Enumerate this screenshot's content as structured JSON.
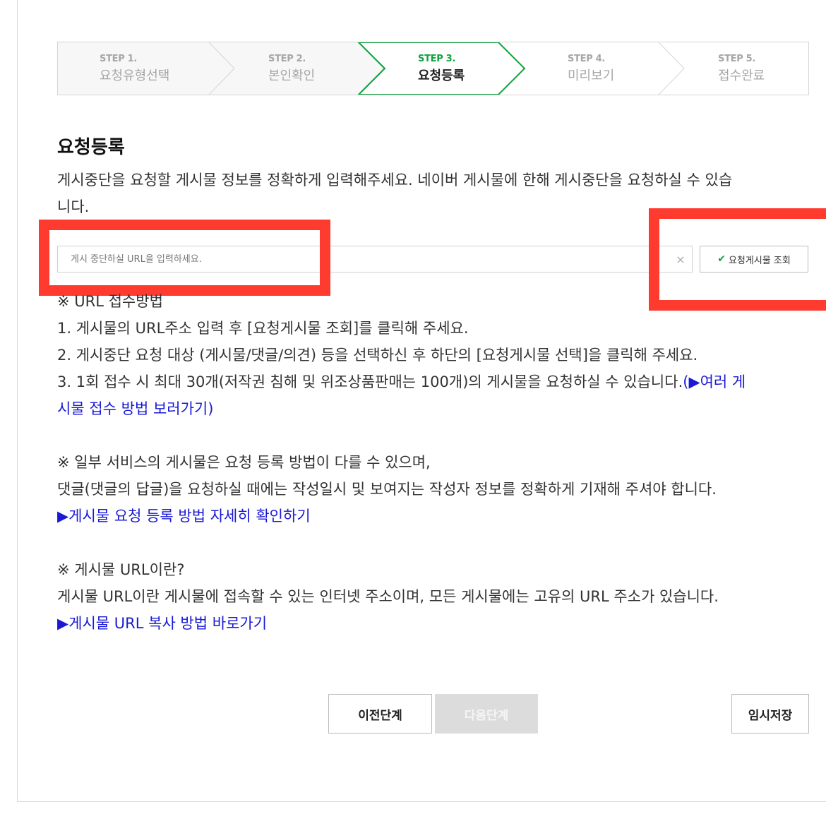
{
  "steps": [
    {
      "num": "STEP 1.",
      "label": "요청유형선택",
      "active": false
    },
    {
      "num": "STEP 2.",
      "label": "본인확인",
      "active": false
    },
    {
      "num": "STEP 3.",
      "label": "요청등록",
      "active": true
    },
    {
      "num": "STEP 4.",
      "label": "미리보기",
      "active": false
    },
    {
      "num": "STEP 5.",
      "label": "접수완료",
      "active": false
    }
  ],
  "section": {
    "title": "요청등록",
    "desc_line1": "게시중단을 요청할 게시물 정보를 정확하게 입력해주세요. 네이버 게시물에 한해 게시중단을 요청하실 수 있습",
    "desc_line2": "니다."
  },
  "url_search": {
    "placeholder": "게시 중단하실 URL을 입력하세요.",
    "clear_label": "×",
    "lookup_label": "요청게시물 조회",
    "lookup_icon": "✔"
  },
  "guide": {
    "header": "※ URL 접수방법",
    "step1": "1. 게시물의 URL주소 입력 후 [요청게시물 조회]를 클릭해 주세요.",
    "step2": "2. 게시중단 요청 대상 (게시물/댓글/의견) 등을 선택하신 후 하단의 [요청게시물 선택]을 클릭해 주세요.",
    "step3": "3. 1회 접수 시 최대 30개(저작권 침해 및 위조상품판매는 100개)의 게시물을 요청하실 수 있습니다.",
    "step3_link": "(▶여러 게",
    "step3_link_cont": "시물 접수 방법 보러가기)",
    "note1": "※ 일부 서비스의 게시물은 요청 등록 방법이 다를 수 있으며,",
    "note2": "댓글(댓글의 답글)을 요청하실 때에는 작성일시 및 보여지는 작성자 정보를 정확하게 기재해 주셔야 합니다.",
    "note_link": "▶게시물 요청 등록 방법 자세히 확인하기",
    "url_q": "※ 게시물 URL이란?",
    "url_desc": "게시물 URL이란 게시물에 접속할 수 있는 인터넷 주소이며, 모든 게시물에는 고유의 URL 주소가 있습니다.",
    "url_link": "▶게시물 URL 복사 방법 바로가기"
  },
  "buttons": {
    "prev": "이전단계",
    "next": "다음단계",
    "save": "임시저장"
  },
  "colors": {
    "active_step": "#0fa33e",
    "link": "#1a1ad6",
    "highlight": "#ff3b30"
  }
}
